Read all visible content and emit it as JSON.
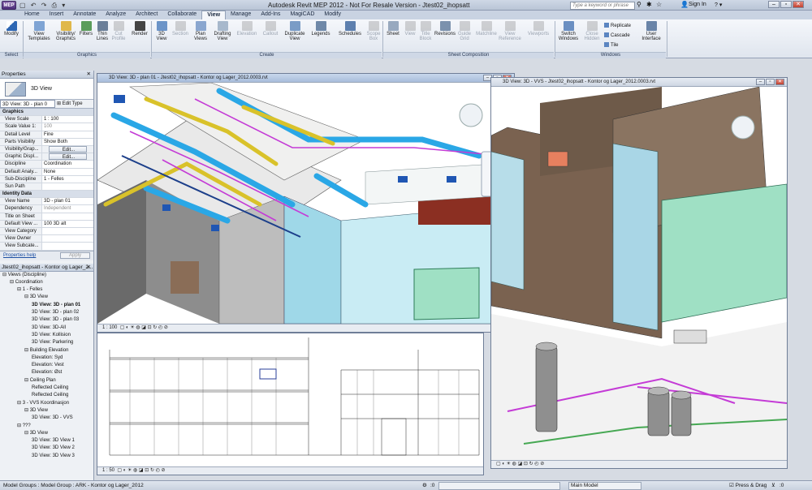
{
  "app": {
    "menu_button": "MEP",
    "title": "Autodesk Revit MEP 2012 - Not For Resale Version - Jtest02_ihopsatt",
    "search_placeholder": "Type a keyword or phrase",
    "sign_in": "Sign In",
    "exchange": "Exchange Apps"
  },
  "tabs": [
    "Home",
    "Insert",
    "Annotate",
    "Analyze",
    "Architect",
    "Collaborate",
    "View",
    "Manage",
    "Add-Ins",
    "MagiCAD",
    "Modify"
  ],
  "active_tab": "View",
  "ribbon": {
    "modify": "Modify",
    "graphics_tools": [
      "View\nTemplates",
      "Visibility/\nGraphics",
      "Filters",
      "Thin\nLines",
      "Cut\nProfile"
    ],
    "create_tools": [
      "Render",
      "3D\nView",
      "Section",
      "Plan\nViews",
      "Drafting\nView",
      "Elevation",
      "Callout",
      "Duplicate\nView",
      "Legends",
      "Schedules",
      "Scope\nBox"
    ],
    "sheet_tools": [
      "Sheet",
      "View",
      "Title\nBlock",
      "Revisions",
      "Guide\nGrid",
      "Matchline",
      "View\nReference",
      "Viewports"
    ],
    "window_tools": [
      "Switch\nWindows",
      "Close\nHidden",
      "Replicate",
      "Cascade",
      "Tile",
      "User\nInterface"
    ],
    "panels": {
      "select": "Select",
      "graphics": "Graphics",
      "create": "Create",
      "sheet": "Sheet Composition",
      "windows": "Windows"
    }
  },
  "properties": {
    "header": "Properties",
    "type_name": "3D View",
    "instance": "3D View: 3D - plan 0",
    "edit_type": "Edit Type",
    "sections": [
      {
        "name": "Graphics",
        "rows": [
          [
            "View Scale",
            "1 : 100"
          ],
          [
            "Scale Value 1:",
            "100"
          ],
          [
            "Detail Level",
            "Fine"
          ],
          [
            "Parts Visibility",
            "Show Both"
          ],
          [
            "Visibility/Grap...",
            "Edit..."
          ],
          [
            "Graphic Displ...",
            "Edit..."
          ],
          [
            "Discipline",
            "Coordination"
          ],
          [
            "Default Analy...",
            "None"
          ],
          [
            "Sub-Discipline",
            "1 - Felles"
          ],
          [
            "Sun Path",
            ""
          ]
        ]
      },
      {
        "name": "Identity Data",
        "rows": [
          [
            "View Name",
            "3D - plan 01"
          ],
          [
            "Dependency",
            "Independent"
          ],
          [
            "Title on Sheet",
            ""
          ],
          [
            "Default View ...",
            "100 3D alt"
          ],
          [
            "View Category",
            ""
          ],
          [
            "View Owner",
            ""
          ],
          [
            "View Subcate...",
            ""
          ]
        ]
      }
    ],
    "help": "Properties help",
    "apply": "Apply"
  },
  "browser": {
    "header": "Jtest02_ihopsatt - Kontor og Lager_2...",
    "items": [
      [
        "Views (Discipline)",
        0,
        false
      ],
      [
        "Coordination",
        1,
        false
      ],
      [
        "1 - Felles",
        2,
        false
      ],
      [
        "3D View",
        3,
        false
      ],
      [
        "3D View: 3D - plan 01",
        4,
        true
      ],
      [
        "3D View: 3D - plan 02",
        4,
        false
      ],
      [
        "3D View: 3D - plan 03",
        4,
        false
      ],
      [
        "3D View: 3D-All",
        4,
        false
      ],
      [
        "3D View: Kollision",
        4,
        false
      ],
      [
        "3D View: Parkering",
        4,
        false
      ],
      [
        "Building Elevation",
        3,
        false
      ],
      [
        "Elevation: Syd",
        4,
        false
      ],
      [
        "Elevation: Vest",
        4,
        false
      ],
      [
        "Elevation: Øst",
        4,
        false
      ],
      [
        "Ceiling Plan",
        3,
        false
      ],
      [
        "Reflected Ceiling",
        4,
        false
      ],
      [
        "Reflected Ceiling",
        4,
        false
      ],
      [
        "3 - VVS Koordinasjon",
        2,
        false
      ],
      [
        "3D View",
        3,
        false
      ],
      [
        "3D View: 3D - VVS",
        4,
        false
      ],
      [
        "???",
        2,
        false
      ],
      [
        "3D View",
        3,
        false
      ],
      [
        "3D View: 3D View 1",
        4,
        false
      ],
      [
        "3D View: 3D View 2",
        4,
        false
      ],
      [
        "3D View: 3D View 3",
        4,
        false
      ]
    ]
  },
  "views": {
    "active_title": "3D View: 3D - plan 01 - Jtest02_ihopsatt - Kontor og Lager_2012.0003.rvt",
    "right_title": "3D View: 3D - VVS - Jtest02_ihopsatt - Kontor og Lager_2012.0003.rvt",
    "active_scale": "1 : 100",
    "elev_scale": "1 : 50"
  },
  "status": {
    "message": "Model Groups : Model Group : ARK - Kontor og Lager_2012",
    "level": ":0",
    "workset": "Main Model",
    "press_drag": "Press & Drag",
    "filter": ":0"
  },
  "colors": {
    "duct_blue": "#2aa7e6",
    "pipe_yellow": "#d9c22a",
    "pipe_magenta": "#c43bd6",
    "glass": "#9fe0c4",
    "brick": "#7a6250",
    "active_title": "#a8bddb"
  }
}
